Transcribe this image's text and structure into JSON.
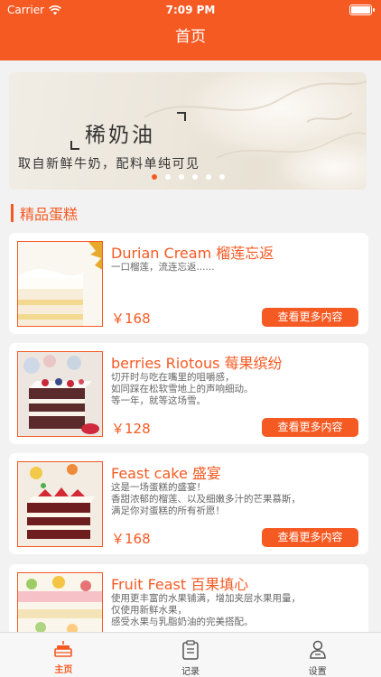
{
  "status_bar": {
    "carrier": "Carrier",
    "time": "7:09 PM"
  },
  "nav": {
    "title": "首页"
  },
  "banner": {
    "title": "稀奶油",
    "subtitle": "取自新鲜牛奶，配料单纯可见",
    "dots": {
      "count": 6,
      "active_index": 0
    }
  },
  "section": {
    "title": "精品蛋糕"
  },
  "products": [
    {
      "title": "Durian Cream 榴莲忘返",
      "desc": "一口榴莲，流连忘返......",
      "price": "￥168",
      "button": "查看更多内容"
    },
    {
      "title": "berries Riotous 莓果缤纷",
      "desc": "切开时与吃在嘴里的咀嚼感，\n如同踩在松软雪地上的声响细动。\n等一年，就等这场雪。",
      "price": "￥128",
      "button": "查看更多内容"
    },
    {
      "title": "Feast cake 盛宴",
      "desc": "这是一场蛋糕的盛宴！\n香甜浓郁的榴莲、以及细嫩多汁的芒果慕斯，\n满足你对蛋糕的所有祈愿！",
      "price": "￥168",
      "button": "查看更多内容"
    },
    {
      "title": "Fruit Feast 百果填心",
      "desc": "使用更丰富的水果铺满，增加夹层水果用量，\n仅使用新鲜水果，\n感受水果与乳脂奶油的完美搭配。",
      "price": "",
      "button": ""
    }
  ],
  "tabbar": {
    "items": [
      {
        "label": "主页",
        "icon": "cake-icon",
        "active": true
      },
      {
        "label": "记录",
        "icon": "clipboard-icon",
        "active": false
      },
      {
        "label": "设置",
        "icon": "user-icon",
        "active": false
      }
    ]
  },
  "colors": {
    "accent": "#f65a23",
    "background": "#f2f2f2"
  }
}
